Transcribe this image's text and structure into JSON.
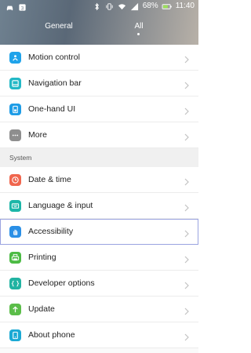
{
  "status": {
    "battery_percent": "68%",
    "time": "11:40"
  },
  "tabs": {
    "general": "General",
    "all": "All"
  },
  "items_top": [
    {
      "label": "Motion control",
      "icon": "motion-icon",
      "color": "#1fa3ea"
    },
    {
      "label": "Navigation bar",
      "icon": "navigation-icon",
      "color": "#22b8c6"
    },
    {
      "label": "One-hand UI",
      "icon": "one-hand-icon",
      "color": "#1e9ce6"
    },
    {
      "label": "More",
      "icon": "more-icon",
      "color": "#8e8e8e"
    }
  ],
  "section": {
    "title": "System"
  },
  "items_system": [
    {
      "label": "Date & time",
      "icon": "clock-icon",
      "color": "#f0664e"
    },
    {
      "label": "Language & input",
      "icon": "keyboard-icon",
      "color": "#1cb6a8"
    },
    {
      "label": "Accessibility",
      "icon": "hand-icon",
      "color": "#2a8fe6"
    },
    {
      "label": "Printing",
      "icon": "printer-icon",
      "color": "#4cbb44"
    },
    {
      "label": "Developer options",
      "icon": "code-icon",
      "color": "#21b3a2"
    },
    {
      "label": "Update",
      "icon": "update-arrow-icon",
      "color": "#5bbd49"
    },
    {
      "label": "About phone",
      "icon": "phone-info-icon",
      "color": "#1ba9d4"
    }
  ]
}
